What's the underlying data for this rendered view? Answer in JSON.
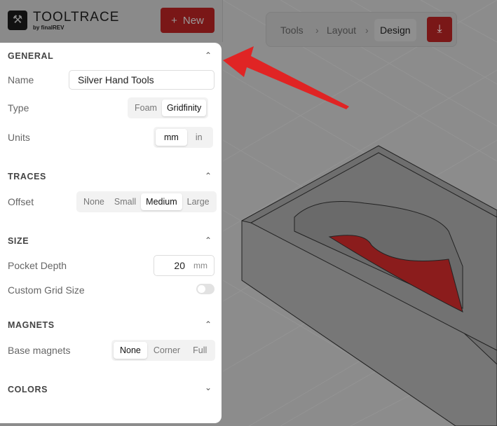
{
  "header": {
    "brand": "TOOLTRACE",
    "byline": "by finalREV",
    "new_label": "New",
    "new_icon": "plus-icon",
    "logo_icon": "wrench-screwdriver-icon"
  },
  "breadcrumb": {
    "items": [
      "Tools",
      "Layout",
      "Design"
    ],
    "active": "Design",
    "download_icon": "download-icon"
  },
  "general": {
    "title": "GENERAL",
    "name_label": "Name",
    "name_value": "Silver Hand Tools",
    "type_label": "Type",
    "type_options": [
      "Foam",
      "Gridfinity"
    ],
    "type_selected": "Gridfinity",
    "units_label": "Units",
    "units_options": [
      "mm",
      "in"
    ],
    "units_selected": "mm"
  },
  "traces": {
    "title": "TRACES",
    "offset_label": "Offset",
    "offset_options": [
      "None",
      "Small",
      "Medium",
      "Large"
    ],
    "offset_selected": "Medium"
  },
  "size": {
    "title": "SIZE",
    "depth_label": "Pocket Depth",
    "depth_value": "20",
    "depth_unit": "mm",
    "grid_label": "Custom Grid Size",
    "grid_enabled": false
  },
  "magnets": {
    "title": "MAGNETS",
    "base_label": "Base magnets",
    "base_options": [
      "None",
      "Corner",
      "Full"
    ],
    "base_selected": "None"
  },
  "colors": {
    "title": "COLORS"
  },
  "colors_accent": {
    "brand": "#7a1717",
    "arrow": "#e02424",
    "pocket": "#8b1c1c"
  }
}
